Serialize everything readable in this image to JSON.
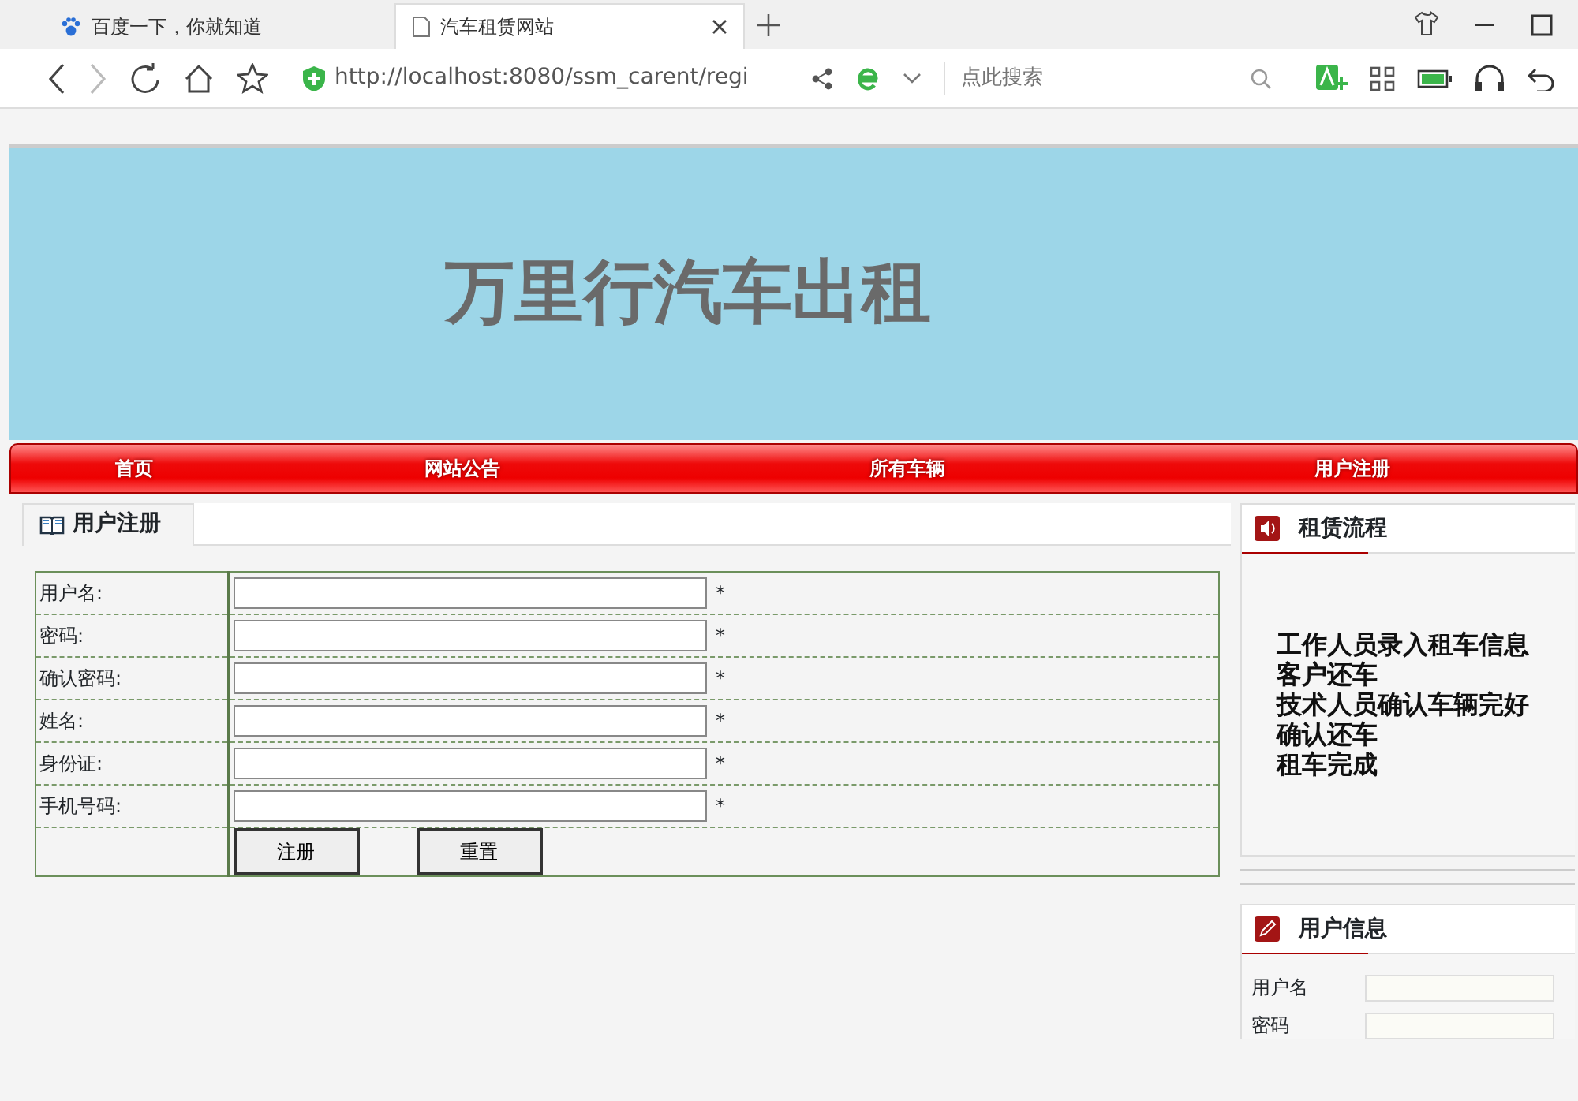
{
  "browser": {
    "tabs": [
      {
        "title": "百度一下，你就知道",
        "selected": false
      },
      {
        "title": "汽车租赁网站",
        "selected": true
      }
    ],
    "address": "http://localhost:8080/ssm_carent/regi",
    "search": {
      "placeholder": "点此搜索"
    }
  },
  "banner": {
    "title": "万里行汽车出租"
  },
  "nav": [
    {
      "label": "首页"
    },
    {
      "label": "网站公告"
    },
    {
      "label": "所有车辆"
    },
    {
      "label": "用户注册"
    }
  ],
  "register": {
    "title": "用户注册",
    "fields": [
      {
        "label": "用户名:",
        "required": "*"
      },
      {
        "label": "密码:",
        "required": "*"
      },
      {
        "label": "确认密码:",
        "required": "*"
      },
      {
        "label": "姓名:",
        "required": "*"
      },
      {
        "label": "身份证:",
        "required": "*"
      },
      {
        "label": "手机号码:",
        "required": "*"
      }
    ],
    "buttons": [
      "注册",
      "重置"
    ]
  },
  "process": {
    "title": "租赁流程",
    "steps": [
      "工作人员录入租车信息",
      "客户还车",
      "技术人员确认车辆完好",
      "确认还车",
      "租车完成"
    ]
  },
  "user_info": {
    "title": "用户信息",
    "fields": [
      {
        "label": "用户名"
      },
      {
        "label": "密码"
      }
    ]
  }
}
